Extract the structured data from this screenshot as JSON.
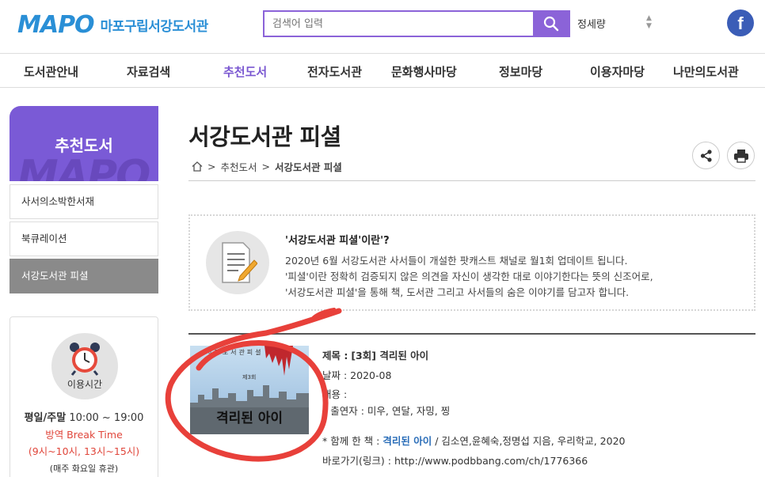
{
  "header": {
    "logo_mark": "MAPO",
    "logo_text": "마포구립서강도서관",
    "search_placeholder": "검색어 입력",
    "sort_label": "정세량",
    "fb_label": "f"
  },
  "nav": {
    "items": [
      "도서관안내",
      "자료검색",
      "추천도서",
      "전자도서관",
      "문화행사마당",
      "정보마당",
      "이용자마당",
      "나만의도서관"
    ]
  },
  "sidebar": {
    "hero_title": "추천도서",
    "hero_watermark": "MAPO",
    "items": [
      "사서의소박한서재",
      "북큐레이션",
      "서강도서관 피셜"
    ],
    "hours": {
      "circle_label": "이용시간",
      "weekday_label": "평일/주말",
      "weekday_time": "10:00 ~ 19:00",
      "break_line": "방역 Break Time",
      "break_time": "(9시~10시, 13시~15시)",
      "closed": "(매주 화요일 휴관)"
    }
  },
  "main": {
    "title": "서강도서관 피셜",
    "breadcrumb": [
      "추천도서",
      "서강도서관 피셜"
    ],
    "intro": {
      "title": "'서강도서관 피셜'이란'?",
      "lines": [
        "2020년 6월 서강도서관 사서들이 개설한 팟캐스트 채널로 월1회 업데이트 됩니다.",
        "'피셜'이란 정확히 검증되지 않은 의견을 자신이 생각한 대로 이야기한다는 뜻의 신조어로,",
        "'서강도서관 피셜'을 통해 책, 도서관 그리고 사서들의 숨은 이야기를 담고자 합니다."
      ]
    },
    "episode": {
      "cover_series": "서강도서관피셜",
      "cover_ep": "제3회",
      "cover_title": "격리된 아이",
      "title_label": "제목 :",
      "title_value": "[3회] 격리된 아이",
      "date_label": "날짜 :",
      "date_value": "2020-08",
      "content_label": "내용 :",
      "cast_line": "* 출연자 : 미우, 연달, 자밍, 찡",
      "book_prefix": "* 함께 한 책 :",
      "book_title": "격리된 아이",
      "book_rest": "/ 김소연,윤혜숙,정명섭 지음, 우리학교, 2020",
      "link_label": "바로가기(링크) :",
      "link_url": "http://www.podbbang.com/ch/1776366"
    }
  },
  "colors": {
    "brand_blue": "#2a8fd6",
    "accent_purple": "#7a5ad6",
    "break_red": "#e0463b",
    "scribble_red": "#e8403a"
  }
}
